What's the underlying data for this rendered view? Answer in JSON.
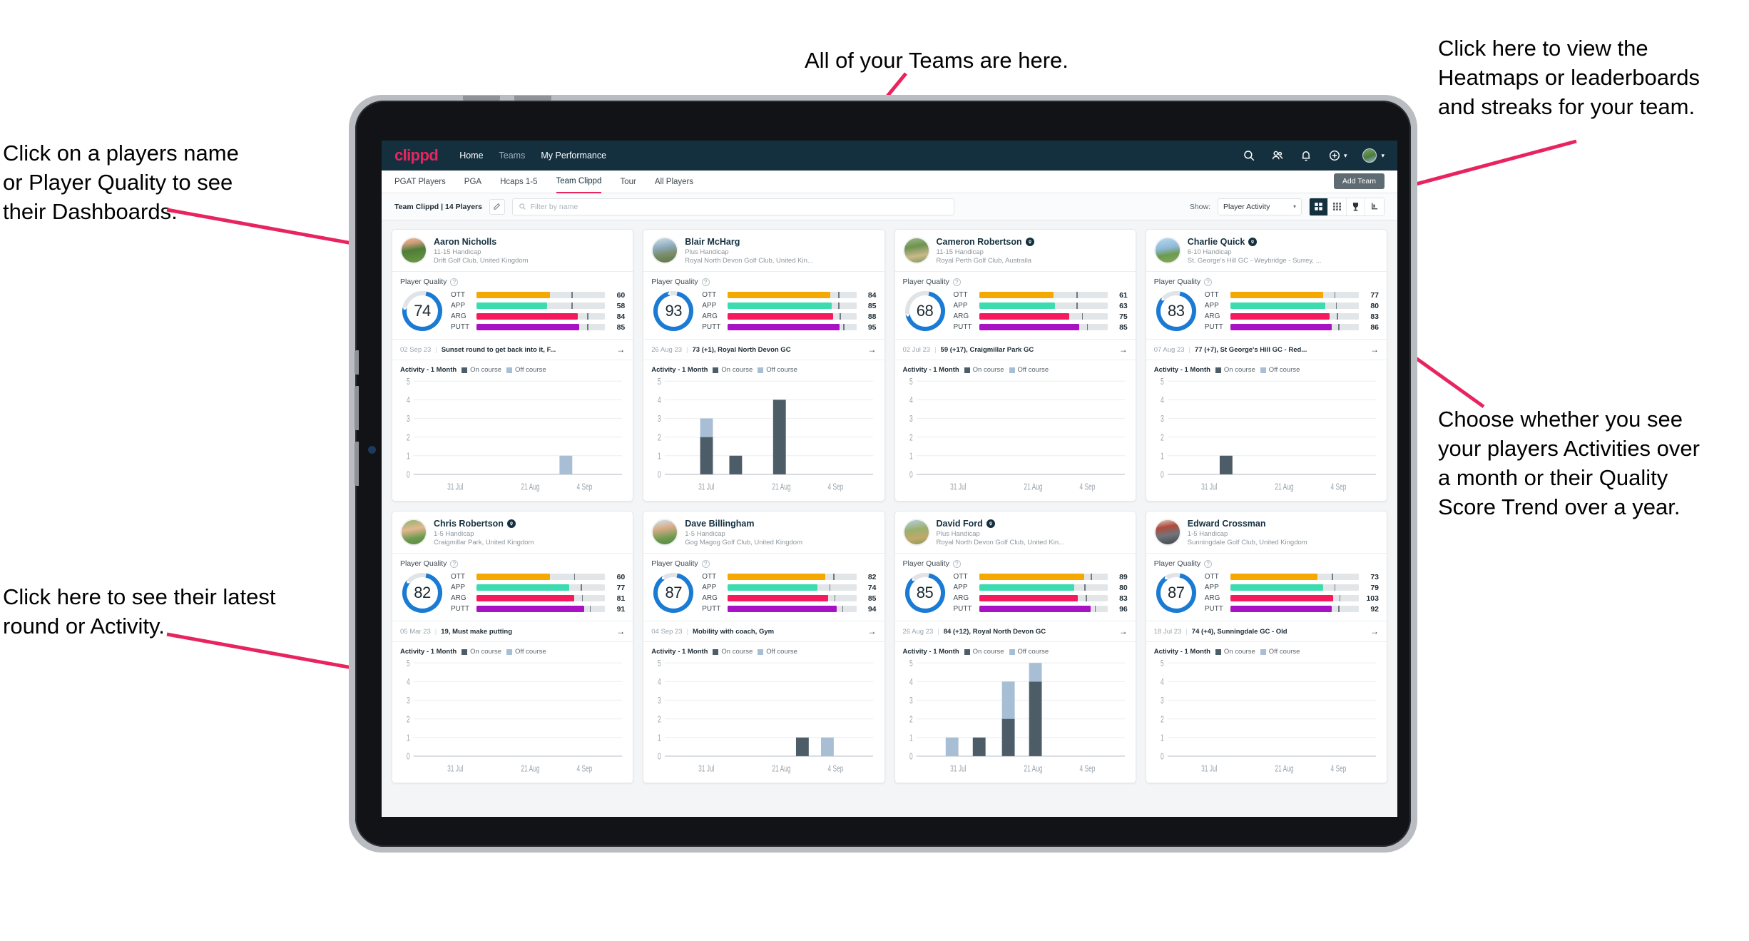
{
  "annotations": [
    {
      "id": "teams",
      "text": "All of your Teams are here."
    },
    {
      "id": "players-name",
      "text": "Click on a players name\nor Player Quality to see\ntheir Dashboards."
    },
    {
      "id": "heatmaps",
      "text": "Click here to view the\nHeatmaps or leaderboards\nand streaks for your team."
    },
    {
      "id": "activity-choice",
      "text": "Choose whether you see\nyour players Activities over\na month or their Quality\nScore Trend over a year."
    },
    {
      "id": "latest-round",
      "text": "Click here to see their latest\nround or Activity."
    }
  ],
  "colors": {
    "brand_pink": "#e8245f",
    "topbar": "#14303f",
    "ott": "#f5a800",
    "app": "#3ddbb0",
    "arg": "#f5195e",
    "putt": "#a811c4",
    "ring": "#1a7bd4",
    "on_course": "#4c5d68",
    "off_course": "#a7bed4"
  },
  "topbar": {
    "logo": "clippd",
    "nav": [
      {
        "label": "Home",
        "active": true
      },
      {
        "label": "Teams",
        "active": false
      },
      {
        "label": "My Performance",
        "active": true
      }
    ],
    "icons": [
      "search-icon",
      "people-icon",
      "bell-icon",
      "plus-circle-icon",
      "avatar"
    ]
  },
  "tabs": [
    {
      "label": "PGAT Players",
      "active": false
    },
    {
      "label": "PGA",
      "active": false
    },
    {
      "label": "Hcaps 1-5",
      "active": false
    },
    {
      "label": "Team Clippd",
      "active": true
    },
    {
      "label": "Tour",
      "active": false
    },
    {
      "label": "All Players",
      "active": false
    }
  ],
  "add_team_button": "Add Team",
  "filterbar": {
    "team_label": "Team Clippd | 14 Players",
    "edit_icon": "pencil-icon",
    "search_placeholder": "Filter by name",
    "search_value": "",
    "show_label": "Show:",
    "show_value": "Player Activity",
    "view_buttons": [
      {
        "name": "grid-large-view",
        "active": true
      },
      {
        "name": "grid-small-view",
        "active": false
      },
      {
        "name": "trophy-leaderboard-view",
        "active": false
      },
      {
        "name": "heatmap-view",
        "active": false
      }
    ]
  },
  "legend": {
    "title": "Activity - 1 Month",
    "on_course": "On course",
    "off_course": "Off course"
  },
  "player_quality_label": "Player Quality",
  "cards": [
    {
      "name": "Aaron Nicholls",
      "verified": false,
      "handicap": "11-15 Handicap",
      "club": "Drift Golf Club, United Kingdom",
      "avatar_css": "linear-gradient(170deg,#f2b88a 0%,#cf9e7d 22%,#4f7d38 48%,#6c9a45 100%)",
      "score": 74,
      "metrics": [
        {
          "label": "OTT",
          "value": 60,
          "fill": 57,
          "tick": 74
        },
        {
          "label": "APP",
          "value": 58,
          "fill": 55,
          "tick": 74
        },
        {
          "label": "ARG",
          "value": 84,
          "fill": 79,
          "tick": 86
        },
        {
          "label": "PUTT",
          "value": 85,
          "fill": 80,
          "tick": 86
        }
      ],
      "round": {
        "date": "02 Sep 23",
        "text": "Sunset round to get back into it, F..."
      },
      "chart": {
        "xticks": [
          "31 Jul",
          "21 Aug",
          "4 Sep"
        ],
        "ymax": 5,
        "bars": [
          {
            "x": 0.7,
            "on": 0,
            "off": 1
          }
        ]
      }
    },
    {
      "name": "Blair McHarg",
      "verified": false,
      "handicap": "Plus Handicap",
      "club": "Royal North Devon Golf Club, United Kin...",
      "avatar_css": "linear-gradient(170deg,#cfe0ea 0%,#8aa7b8 40%,#7c8f6b 62%,#5d7548 100%)",
      "score": 93,
      "metrics": [
        {
          "label": "OTT",
          "value": 84,
          "fill": 80,
          "tick": 86
        },
        {
          "label": "APP",
          "value": 85,
          "fill": 81,
          "tick": 86
        },
        {
          "label": "ARG",
          "value": 88,
          "fill": 82,
          "tick": 87
        },
        {
          "label": "PUTT",
          "value": 95,
          "fill": 87,
          "tick": 90
        }
      ],
      "round": {
        "date": "26 Aug 23",
        "text": "73 (+1), Royal North Devon GC"
      },
      "chart": {
        "xticks": [
          "31 Jul",
          "21 Aug",
          "4 Sep"
        ],
        "ymax": 5,
        "bars": [
          {
            "x": 0.17,
            "on": 2,
            "off": 1
          },
          {
            "x": 0.31,
            "on": 1,
            "off": 0
          },
          {
            "x": 0.52,
            "on": 4,
            "off": 0
          }
        ]
      }
    },
    {
      "name": "Cameron Robertson",
      "verified": true,
      "handicap": "11-15 Handicap",
      "club": "Royal Perth Golf Club, Australia",
      "avatar_css": "linear-gradient(170deg,#9fb98a 0%,#6d9350 35%,#c9b98a 70%,#7d9a55 100%)",
      "score": 68,
      "metrics": [
        {
          "label": "OTT",
          "value": 61,
          "fill": 58,
          "tick": 76
        },
        {
          "label": "APP",
          "value": 63,
          "fill": 59,
          "tick": 76
        },
        {
          "label": "ARG",
          "value": 75,
          "fill": 70,
          "tick": 80
        },
        {
          "label": "PUTT",
          "value": 85,
          "fill": 78,
          "tick": 84
        }
      ],
      "round": {
        "date": "02 Jul 23",
        "text": "59 (+17), Craigmillar Park GC"
      },
      "chart": {
        "xticks": [
          "31 Jul",
          "21 Aug",
          "4 Sep"
        ],
        "ymax": 5,
        "bars": []
      }
    },
    {
      "name": "Charlie Quick",
      "verified": true,
      "handicap": "6-10 Handicap",
      "club": "St. George's Hill GC - Weybridge - Surrey, ...",
      "avatar_css": "linear-gradient(170deg,#b9d9ef 0%,#8fbad8 40%,#6d9a4f 66%,#86ab57 100%)",
      "score": 83,
      "metrics": [
        {
          "label": "OTT",
          "value": 77,
          "fill": 72,
          "tick": 81
        },
        {
          "label": "APP",
          "value": 80,
          "fill": 74,
          "tick": 82
        },
        {
          "label": "ARG",
          "value": 83,
          "fill": 77,
          "tick": 83
        },
        {
          "label": "PUTT",
          "value": 86,
          "fill": 79,
          "tick": 84
        }
      ],
      "round": {
        "date": "07 Aug 23",
        "text": "77 (+7), St George's Hill GC - Red..."
      },
      "chart": {
        "xticks": [
          "31 Jul",
          "21 Aug",
          "4 Sep"
        ],
        "ymax": 5,
        "bars": [
          {
            "x": 0.25,
            "on": 1,
            "off": 0
          }
        ]
      }
    },
    {
      "name": "Chris Robertson",
      "verified": true,
      "handicap": "1-5 Handicap",
      "club": "Craigmillar Park, United Kingdom",
      "avatar_css": "linear-gradient(170deg,#8fb56a 0%,#e2b78f 38%,#6d9a4f 72%,#5b8a42 100%)",
      "score": 82,
      "metrics": [
        {
          "label": "OTT",
          "value": 60,
          "fill": 57,
          "tick": 76
        },
        {
          "label": "APP",
          "value": 77,
          "fill": 72,
          "tick": 81
        },
        {
          "label": "ARG",
          "value": 81,
          "fill": 76,
          "tick": 82
        },
        {
          "label": "PUTT",
          "value": 91,
          "fill": 84,
          "tick": 88
        }
      ],
      "round": {
        "date": "05 Mar 23",
        "text": "19, Must make putting"
      },
      "chart": {
        "xticks": [
          "31 Jul",
          "21 Aug",
          "4 Sep"
        ],
        "ymax": 5,
        "bars": []
      }
    },
    {
      "name": "Dave Billingham",
      "verified": false,
      "handicap": "1-5 Handicap",
      "club": "Gog Magog Golf Club, United Kingdom",
      "avatar_css": "linear-gradient(170deg,#cbe2ef 0%,#d9ab86 35%,#6e9a50 72%,#5a8a43 100%)",
      "score": 87,
      "metrics": [
        {
          "label": "OTT",
          "value": 82,
          "fill": 76,
          "tick": 82
        },
        {
          "label": "APP",
          "value": 74,
          "fill": 70,
          "tick": 79
        },
        {
          "label": "ARG",
          "value": 85,
          "fill": 78,
          "tick": 83
        },
        {
          "label": "PUTT",
          "value": 94,
          "fill": 85,
          "tick": 89
        }
      ],
      "round": {
        "date": "04 Sep 23",
        "text": "Mobility with coach, Gym"
      },
      "chart": {
        "xticks": [
          "31 Jul",
          "21 Aug",
          "4 Sep"
        ],
        "ymax": 5,
        "bars": [
          {
            "x": 0.63,
            "on": 1,
            "off": 0
          },
          {
            "x": 0.75,
            "on": 0,
            "off": 1
          }
        ]
      }
    },
    {
      "name": "David Ford",
      "verified": true,
      "handicap": "Plus Handicap",
      "club": "Royal North Devon Golf Club, United Kin...",
      "avatar_css": "linear-gradient(170deg,#b7cfe0 0%,#9ab06e 40%,#c2a86a 72%,#8a9b58 100%)",
      "score": 85,
      "metrics": [
        {
          "label": "OTT",
          "value": 89,
          "fill": 82,
          "tick": 87
        },
        {
          "label": "APP",
          "value": 80,
          "fill": 74,
          "tick": 82
        },
        {
          "label": "ARG",
          "value": 83,
          "fill": 77,
          "tick": 83
        },
        {
          "label": "PUTT",
          "value": 96,
          "fill": 87,
          "tick": 90
        }
      ],
      "round": {
        "date": "26 Aug 23",
        "text": "84 (+12), Royal North Devon GC"
      },
      "chart": {
        "xticks": [
          "31 Jul",
          "21 Aug",
          "4 Sep"
        ],
        "ymax": 5,
        "bars": [
          {
            "x": 0.14,
            "on": 0,
            "off": 1
          },
          {
            "x": 0.27,
            "on": 1,
            "off": 0
          },
          {
            "x": 0.41,
            "on": 2,
            "off": 2
          },
          {
            "x": 0.54,
            "on": 4,
            "off": 1
          }
        ]
      }
    },
    {
      "name": "Edward Crossman",
      "verified": false,
      "handicap": "1-5 Handicap",
      "club": "Sunningdale Golf Club, United Kingdom",
      "avatar_css": "linear-gradient(170deg,#d8d2c9 0%,#b24a3a 30%,#6f757a 60%,#3f464c 100%)",
      "score": 87,
      "metrics": [
        {
          "label": "OTT",
          "value": 73,
          "fill": 68,
          "tick": 79
        },
        {
          "label": "APP",
          "value": 79,
          "fill": 72,
          "tick": 81
        },
        {
          "label": "ARG",
          "value": 103,
          "fill": 80,
          "tick": 85
        },
        {
          "label": "PUTT",
          "value": 92,
          "fill": 79,
          "tick": 84
        }
      ],
      "round": {
        "date": "18 Jul 23",
        "text": "74 (+4), Sunningdale GC - Old"
      },
      "chart": {
        "xticks": [
          "31 Jul",
          "21 Aug",
          "4 Sep"
        ],
        "ymax": 5,
        "bars": []
      }
    }
  ]
}
